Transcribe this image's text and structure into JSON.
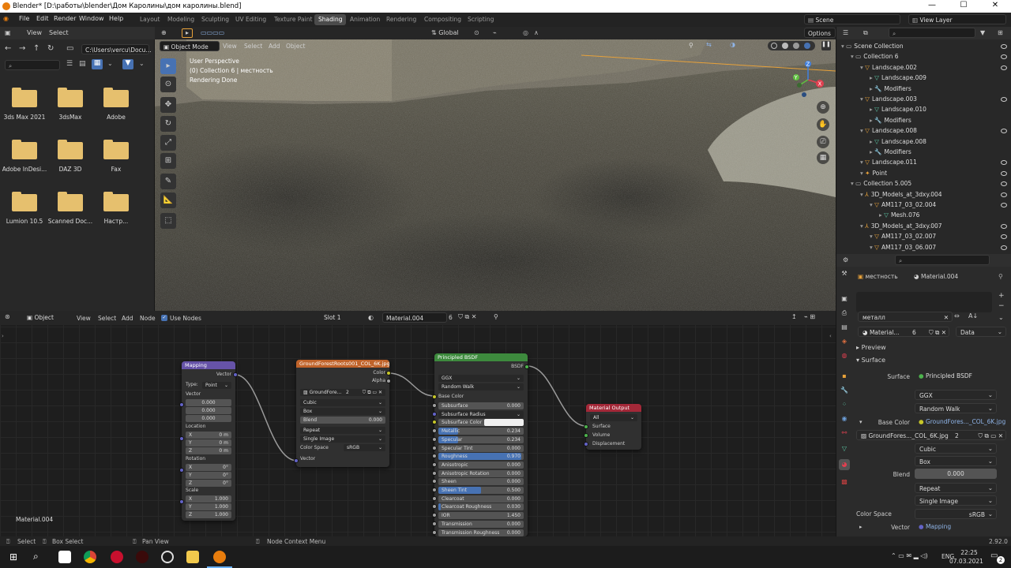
{
  "window": {
    "title": "Blender* [D:\\работы\\blender\\Дом Каролины\\дом каролины.blend]",
    "minimize": "—",
    "maximize": "☐",
    "close": "✕"
  },
  "menu": [
    "File",
    "Edit",
    "Render",
    "Window",
    "Help"
  ],
  "workspaces": [
    "Layout",
    "Modeling",
    "Sculpting",
    "UV Editing",
    "Texture Paint",
    "Shading",
    "Animation",
    "Rendering",
    "Compositing",
    "Scripting"
  ],
  "active_workspace": "Shading",
  "scene": "Scene",
  "view_layer": "View Layer",
  "filebrowser": {
    "view_label": "View",
    "select_label": "Select",
    "path": "C:\\Users\\vercu\\Docu...",
    "folders": [
      "3ds Max 2021",
      "3dsMax",
      "Adobe",
      "Adobe InDesi...",
      "DAZ 3D",
      "Fax",
      "Lumion 10.5",
      "Scanned Doc...",
      "Настр..."
    ]
  },
  "viewport": {
    "mode": "Object Mode",
    "menu": [
      "View",
      "Select",
      "Add",
      "Object"
    ],
    "transform": "Global",
    "options_label": "Options",
    "overlay_lines": [
      "User Perspective",
      "(0) Collection 6 | местность",
      "Rendering Done"
    ],
    "gizmo_axes": [
      "X",
      "Y",
      "Z"
    ]
  },
  "node_editor": {
    "type": "Object",
    "menu": [
      "View",
      "Select",
      "Add",
      "Node"
    ],
    "use_nodes_label": "Use Nodes",
    "slot": "Slot 1",
    "material": "Material.004",
    "users": "6",
    "material_label": "Material.004",
    "mapping": {
      "title": "Mapping",
      "vector_out": "Vector",
      "type_label": "Type:",
      "type_value": "Point",
      "vector_label": "Vector",
      "vector_values": [
        "0.000",
        "0.000",
        "0.000"
      ],
      "location_label": "Location",
      "location": [
        {
          "axis": "X",
          "val": "0 m"
        },
        {
          "axis": "Y",
          "val": "0 m"
        },
        {
          "axis": "Z",
          "val": "0 m"
        }
      ],
      "rotation_label": "Rotation",
      "rotation": [
        {
          "axis": "X",
          "val": "0°"
        },
        {
          "axis": "Y",
          "val": "0°"
        },
        {
          "axis": "Z",
          "val": "0°"
        }
      ],
      "scale_label": "Scale",
      "scale": [
        {
          "axis": "X",
          "val": "1.000"
        },
        {
          "axis": "Y",
          "val": "1.000"
        },
        {
          "axis": "Z",
          "val": "1.000"
        }
      ]
    },
    "image_texture": {
      "title": "GroundForestRoots001_COL_6K.jpg",
      "color_out": "Color",
      "alpha_out": "Alpha",
      "image_name": "GroundFore...",
      "image_users": "2",
      "interpolation": "Cubic",
      "projection": "Box",
      "blend_label": "Blend",
      "blend_value": "0.000",
      "extension": "Repeat",
      "source": "Single Image",
      "color_space_label": "Color Space",
      "color_space": "sRGB",
      "vector_in": "Vector"
    },
    "bsdf": {
      "title": "Principled BSDF",
      "out": "BSDF",
      "distribution": "GGX",
      "subsurface_method": "Random Walk",
      "base_color": "Base Color",
      "inputs": [
        {
          "name": "Subsurface",
          "val": "0.000",
          "fill": 0
        },
        {
          "name": "Subsurface Radius",
          "val": "",
          "fill": 0
        },
        {
          "name": "Subsurface Color",
          "val": "",
          "fill": 0
        },
        {
          "name": "Metallic",
          "val": "0.234",
          "fill": 0.234
        },
        {
          "name": "Specular",
          "val": "0.234",
          "fill": 0.234
        },
        {
          "name": "Specular Tint",
          "val": "0.000",
          "fill": 0
        },
        {
          "name": "Roughness",
          "val": "0.970",
          "fill": 0.97
        },
        {
          "name": "Anisotropic",
          "val": "0.000",
          "fill": 0
        },
        {
          "name": "Anisotropic Rotation",
          "val": "0.000",
          "fill": 0
        },
        {
          "name": "Sheen",
          "val": "0.000",
          "fill": 0
        },
        {
          "name": "Sheen Tint",
          "val": "0.500",
          "fill": 0.5
        },
        {
          "name": "Clearcoat",
          "val": "0.000",
          "fill": 0
        },
        {
          "name": "Clearcoat Roughness",
          "val": "0.030",
          "fill": 0.03
        },
        {
          "name": "IOR",
          "val": "1.450",
          "fill": 0
        },
        {
          "name": "Transmission",
          "val": "0.000",
          "fill": 0
        },
        {
          "name": "Transmission Roughness",
          "val": "0.000",
          "fill": 0
        }
      ]
    },
    "output": {
      "title": "Material Output",
      "target": "All",
      "inputs": [
        "Surface",
        "Volume",
        "Displacement"
      ]
    }
  },
  "outliner": {
    "items": [
      {
        "label": "Scene Collection",
        "indent": 0,
        "kind": "collection",
        "color": "#bbbbbb"
      },
      {
        "label": "Collection 6",
        "indent": 1,
        "kind": "collection",
        "color": "#bbbbbb"
      },
      {
        "label": "Landscape.002",
        "indent": 2,
        "kind": "object",
        "color": "#e8a23a"
      },
      {
        "label": "Landscape.009",
        "indent": 3,
        "kind": "mesh",
        "color": "#5cc9a7"
      },
      {
        "label": "Modifiers",
        "indent": 3,
        "kind": "modifier",
        "color": "#6d9fd9"
      },
      {
        "label": "Landscape.003",
        "indent": 2,
        "kind": "object",
        "color": "#e8a23a"
      },
      {
        "label": "Landscape.010",
        "indent": 3,
        "kind": "mesh",
        "color": "#5cc9a7"
      },
      {
        "label": "Modifiers",
        "indent": 3,
        "kind": "modifier",
        "color": "#6d9fd9"
      },
      {
        "label": "Landscape.008",
        "indent": 2,
        "kind": "object",
        "color": "#e8a23a"
      },
      {
        "label": "Landscape.008",
        "indent": 3,
        "kind": "mesh",
        "color": "#5cc9a7"
      },
      {
        "label": "Modifiers",
        "indent": 3,
        "kind": "modifier",
        "color": "#6d9fd9"
      },
      {
        "label": "Landscape.011",
        "indent": 2,
        "kind": "object",
        "color": "#e8a23a"
      },
      {
        "label": "Point",
        "indent": 2,
        "kind": "light",
        "color": "#e8a23a"
      },
      {
        "label": "Collection 5.005",
        "indent": 1,
        "kind": "collection",
        "color": "#bbbbbb"
      },
      {
        "label": "3D_Models_at_3dxy.004",
        "indent": 2,
        "kind": "empty",
        "color": "#e8a23a"
      },
      {
        "label": "AM117_03_02.004",
        "indent": 3,
        "kind": "object",
        "color": "#e8a23a"
      },
      {
        "label": "Mesh.076",
        "indent": 4,
        "kind": "mesh",
        "color": "#5cc9a7"
      },
      {
        "label": "3D_Models_at_3dxy.007",
        "indent": 2,
        "kind": "empty",
        "color": "#e8a23a"
      },
      {
        "label": "AM117_03_02.007",
        "indent": 3,
        "kind": "object",
        "color": "#e8a23a"
      },
      {
        "label": "AM117_03_06.007",
        "indent": 3,
        "kind": "object",
        "color": "#e8a23a"
      }
    ]
  },
  "properties": {
    "object": "местность",
    "material": "Material.004",
    "filter_value": "металл",
    "material_slot_name": "Material...",
    "material_users": "6",
    "data_mode": "Data",
    "preview_label": "Preview",
    "surface_panel": "Surface",
    "surface_label": "Surface",
    "surface_value": "Principled BSDF",
    "distribution": "GGX",
    "subsurface_method": "Random Walk",
    "base_color_label": "Base Color",
    "base_color_value": "GroundFores..._COL_6K.jpg",
    "image_name": "GroundFores..._COL_6K.jpg",
    "image_users": "2",
    "interpolation": "Cubic",
    "projection": "Box",
    "blend_label": "Blend",
    "blend_value": "0.000",
    "extension": "Repeat",
    "source": "Single Image",
    "color_space_label": "Color Space",
    "color_space": "sRGB",
    "vector_label": "Vector",
    "vector_value": "Mapping"
  },
  "statusbar": {
    "select": "Select",
    "box_select": "Box Select",
    "pan_view": "Pan View",
    "context_menu": "Node Context Menu",
    "version": "2.92.0"
  },
  "taskbar": {
    "lang": "ENG",
    "time": "22:25",
    "date": "07.03.2021",
    "notifications": "2"
  },
  "colors": {
    "accent": "#4772b3",
    "mapping_header": "#6653a8",
    "texture_header": "#c0632a",
    "bsdf_header": "#3d8a3d",
    "output_header": "#a32838",
    "folder": "#e6c06e"
  }
}
